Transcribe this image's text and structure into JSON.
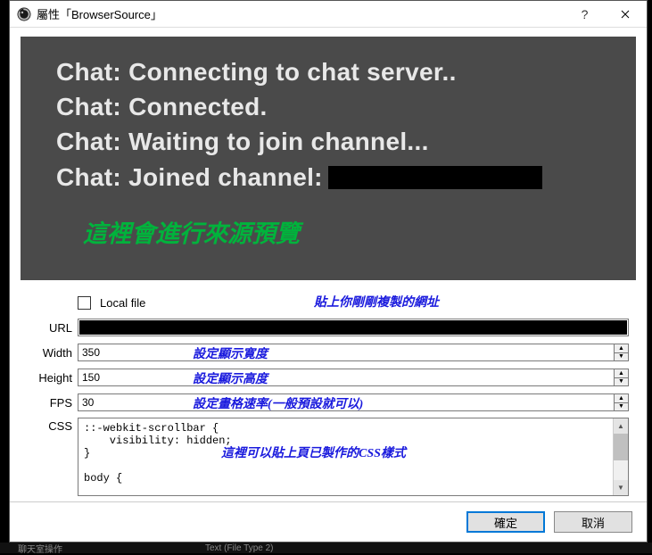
{
  "titlebar": {
    "title": "屬性「BrowserSource」"
  },
  "preview": {
    "chat_lines": [
      "Chat: Connecting to chat server..",
      "Chat: Connected.",
      "Chat: Waiting to join channel...",
      "Chat: Joined channel:"
    ],
    "annotation": "這裡會進行來源預覽"
  },
  "form": {
    "local_file_label": "Local file",
    "local_file_checked": false,
    "url": {
      "label": "URL",
      "annotation": "貼上你剛剛複製的網址"
    },
    "width": {
      "label": "Width",
      "value": "350",
      "annotation": "設定顯示寛度"
    },
    "height": {
      "label": "Height",
      "value": "150",
      "annotation": "設定顯示高度"
    },
    "fps": {
      "label": "FPS",
      "value": "30",
      "annotation": "設定畫格速率(一般預設就可以)"
    },
    "css": {
      "label": "CSS",
      "value": "::-webkit-scrollbar {\n    visibility: hidden;\n}\n\nbody {",
      "annotation": "這裡可以貼上頁已製作的CSS樣式"
    }
  },
  "buttons": {
    "ok": "確定",
    "cancel": "取消"
  },
  "behind": {
    "item1": "聊天室操作",
    "item2": "Text (File Type 2)"
  }
}
